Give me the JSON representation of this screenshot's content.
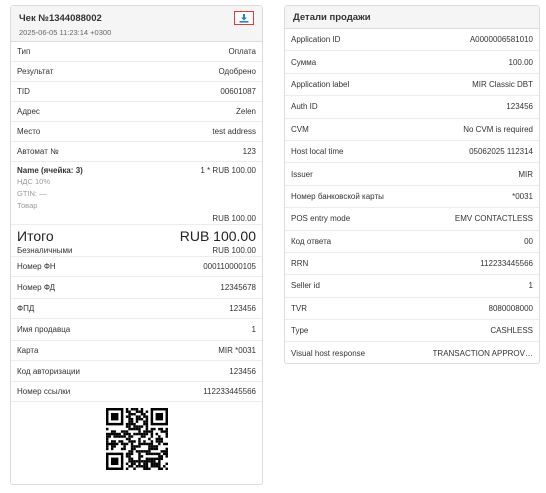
{
  "receipt": {
    "title": "Чек №1344088002",
    "datetime": "2025-06-05 11:23:14 +0300",
    "download_icon": "download-icon",
    "top_rows": [
      {
        "label": "Тип",
        "value": "Оплата"
      },
      {
        "label": "Результат",
        "value": "Одобрено"
      },
      {
        "label": "TID",
        "value": "00601087"
      },
      {
        "label": "Адрес",
        "value": "Zelen"
      },
      {
        "label": "Место",
        "value": "test address"
      },
      {
        "label": "Автомат №",
        "value": "123"
      }
    ],
    "item": {
      "name": "Name (ячейка: 3)",
      "qty_price": "1 * RUB 100.00",
      "vat": "НДС 10%",
      "gtin": "GTIN: —",
      "kind": "Товар",
      "sum": "RUB 100.00"
    },
    "total_label": "Итого",
    "total_value": "RUB 100.00",
    "bottom_rows": [
      {
        "label": "Безналичными",
        "value": "RUB 100.00"
      },
      {
        "label": "Номер ФН",
        "value": "000110000105"
      },
      {
        "label": "Номер ФД",
        "value": "12345678"
      },
      {
        "label": "ФПД",
        "value": "123456"
      },
      {
        "label": "Имя продавца",
        "value": "1"
      },
      {
        "label": "Карта",
        "value": "MIR *0031"
      },
      {
        "label": "Код авторизации",
        "value": "123456"
      },
      {
        "label": "Номер ссылки",
        "value": "112233445566"
      }
    ]
  },
  "details": {
    "title": "Детали продажи",
    "rows": [
      {
        "label": "Application ID",
        "value": "A0000006581010"
      },
      {
        "label": "Сумма",
        "value": "100.00"
      },
      {
        "label": "Application label",
        "value": "MIR Classic DBT"
      },
      {
        "label": "Auth ID",
        "value": "123456"
      },
      {
        "label": "CVM",
        "value": "No CVM is required"
      },
      {
        "label": "Host local time",
        "value": "05062025 112314"
      },
      {
        "label": "Issuer",
        "value": "MIR"
      },
      {
        "label": "Номер банковской карты",
        "value": "*0031"
      },
      {
        "label": "POS entry mode",
        "value": "EMV CONTACTLESS"
      },
      {
        "label": "Код ответа",
        "value": "00"
      },
      {
        "label": "RRN",
        "value": "112233445566"
      },
      {
        "label": "Seller id",
        "value": "1"
      },
      {
        "label": "TVR",
        "value": "8080008000"
      },
      {
        "label": "Type",
        "value": "CASHLESS"
      },
      {
        "label": "Visual host response",
        "value": "TRANSACTION APPROV…"
      }
    ]
  }
}
